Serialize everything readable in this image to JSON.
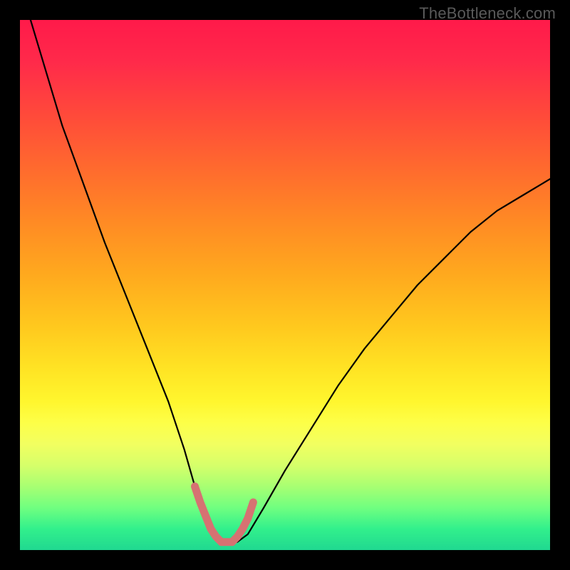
{
  "watermark": "TheBottleneck.com",
  "chart_data": {
    "type": "line",
    "title": "",
    "xlabel": "",
    "ylabel": "",
    "xlim": [
      0,
      100
    ],
    "ylim": [
      0,
      100
    ],
    "grid": false,
    "legend": false,
    "notes": "V-shaped bottleneck curve over red→yellow→green vertical gradient. No visible axis ticks or numeric labels; x/y are normalized 0–100. Lower is better (green band near y≈0–5). A salmon-colored marker segment highlights the bottom of the valley.",
    "series": [
      {
        "name": "bottleneck-curve",
        "color": "#000000",
        "x": [
          2,
          5,
          8,
          12,
          16,
          20,
          24,
          28,
          31,
          33,
          35,
          37,
          39,
          41,
          43,
          46,
          50,
          55,
          60,
          65,
          70,
          75,
          80,
          85,
          90,
          95,
          100
        ],
        "y": [
          100,
          90,
          80,
          69,
          58,
          48,
          38,
          28,
          19,
          12,
          7,
          3,
          1.5,
          1.5,
          3,
          8,
          15,
          23,
          31,
          38,
          44,
          50,
          55,
          60,
          64,
          67,
          70
        ]
      },
      {
        "name": "valley-highlight",
        "color": "#d67272",
        "x": [
          33,
          34,
          35,
          36,
          37,
          38,
          39,
          40,
          41,
          42,
          43,
          44
        ],
        "y": [
          12,
          9,
          6.5,
          4,
          2.5,
          1.5,
          1.5,
          1.5,
          2.5,
          4,
          6,
          9
        ]
      }
    ]
  }
}
